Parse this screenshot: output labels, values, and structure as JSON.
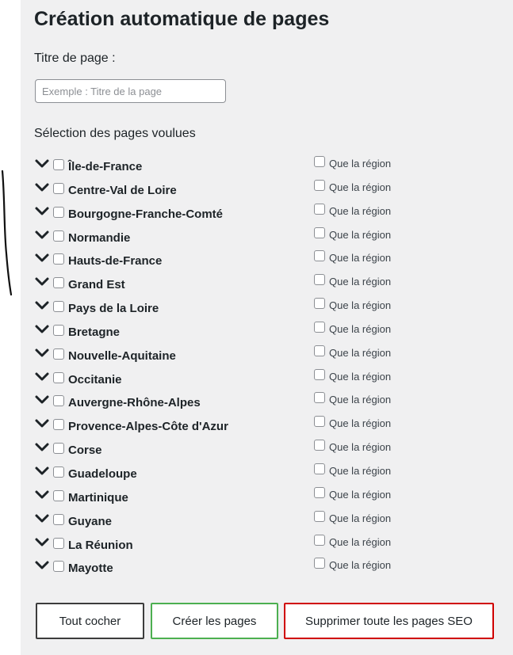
{
  "header": {
    "title": "Création automatique de pages"
  },
  "form": {
    "page_title_label": "Titre de page :",
    "page_title_value": "",
    "page_title_placeholder": "Exemple : Titre de la page",
    "selection_label": "Sélection des pages voulues",
    "only_region_label": "Que la région"
  },
  "regions": [
    {
      "name": "Île-de-France",
      "checked": false,
      "only_region": false
    },
    {
      "name": "Centre-Val de Loire",
      "checked": false,
      "only_region": false
    },
    {
      "name": "Bourgogne-Franche-Comté",
      "checked": false,
      "only_region": false
    },
    {
      "name": "Normandie",
      "checked": false,
      "only_region": false
    },
    {
      "name": "Hauts-de-France",
      "checked": false,
      "only_region": false
    },
    {
      "name": "Grand Est",
      "checked": false,
      "only_region": false
    },
    {
      "name": "Pays de la Loire",
      "checked": false,
      "only_region": false
    },
    {
      "name": "Bretagne",
      "checked": false,
      "only_region": false
    },
    {
      "name": "Nouvelle-Aquitaine",
      "checked": false,
      "only_region": false
    },
    {
      "name": "Occitanie",
      "checked": false,
      "only_region": false
    },
    {
      "name": "Auvergne-Rhône-Alpes",
      "checked": false,
      "only_region": false
    },
    {
      "name": "Provence-Alpes-Côte d'Azur",
      "checked": false,
      "only_region": false
    },
    {
      "name": "Corse",
      "checked": false,
      "only_region": false
    },
    {
      "name": "Guadeloupe",
      "checked": false,
      "only_region": false
    },
    {
      "name": "Martinique",
      "checked": false,
      "only_region": false
    },
    {
      "name": "Guyane",
      "checked": false,
      "only_region": false
    },
    {
      "name": "La Réunion",
      "checked": false,
      "only_region": false
    },
    {
      "name": "Mayotte",
      "checked": false,
      "only_region": false
    }
  ],
  "icons": {
    "expand": "chevron-down-icon"
  },
  "actions": {
    "check_all_label": "Tout cocher",
    "create_pages_label": "Créer les pages",
    "delete_seo_pages_label": "Supprimer toute les pages SEO"
  },
  "colors": {
    "panel_background": "#f0f0f1",
    "check_all_border": "#3c3c3c",
    "create_border": "#4caf50",
    "delete_border": "#d00000"
  }
}
